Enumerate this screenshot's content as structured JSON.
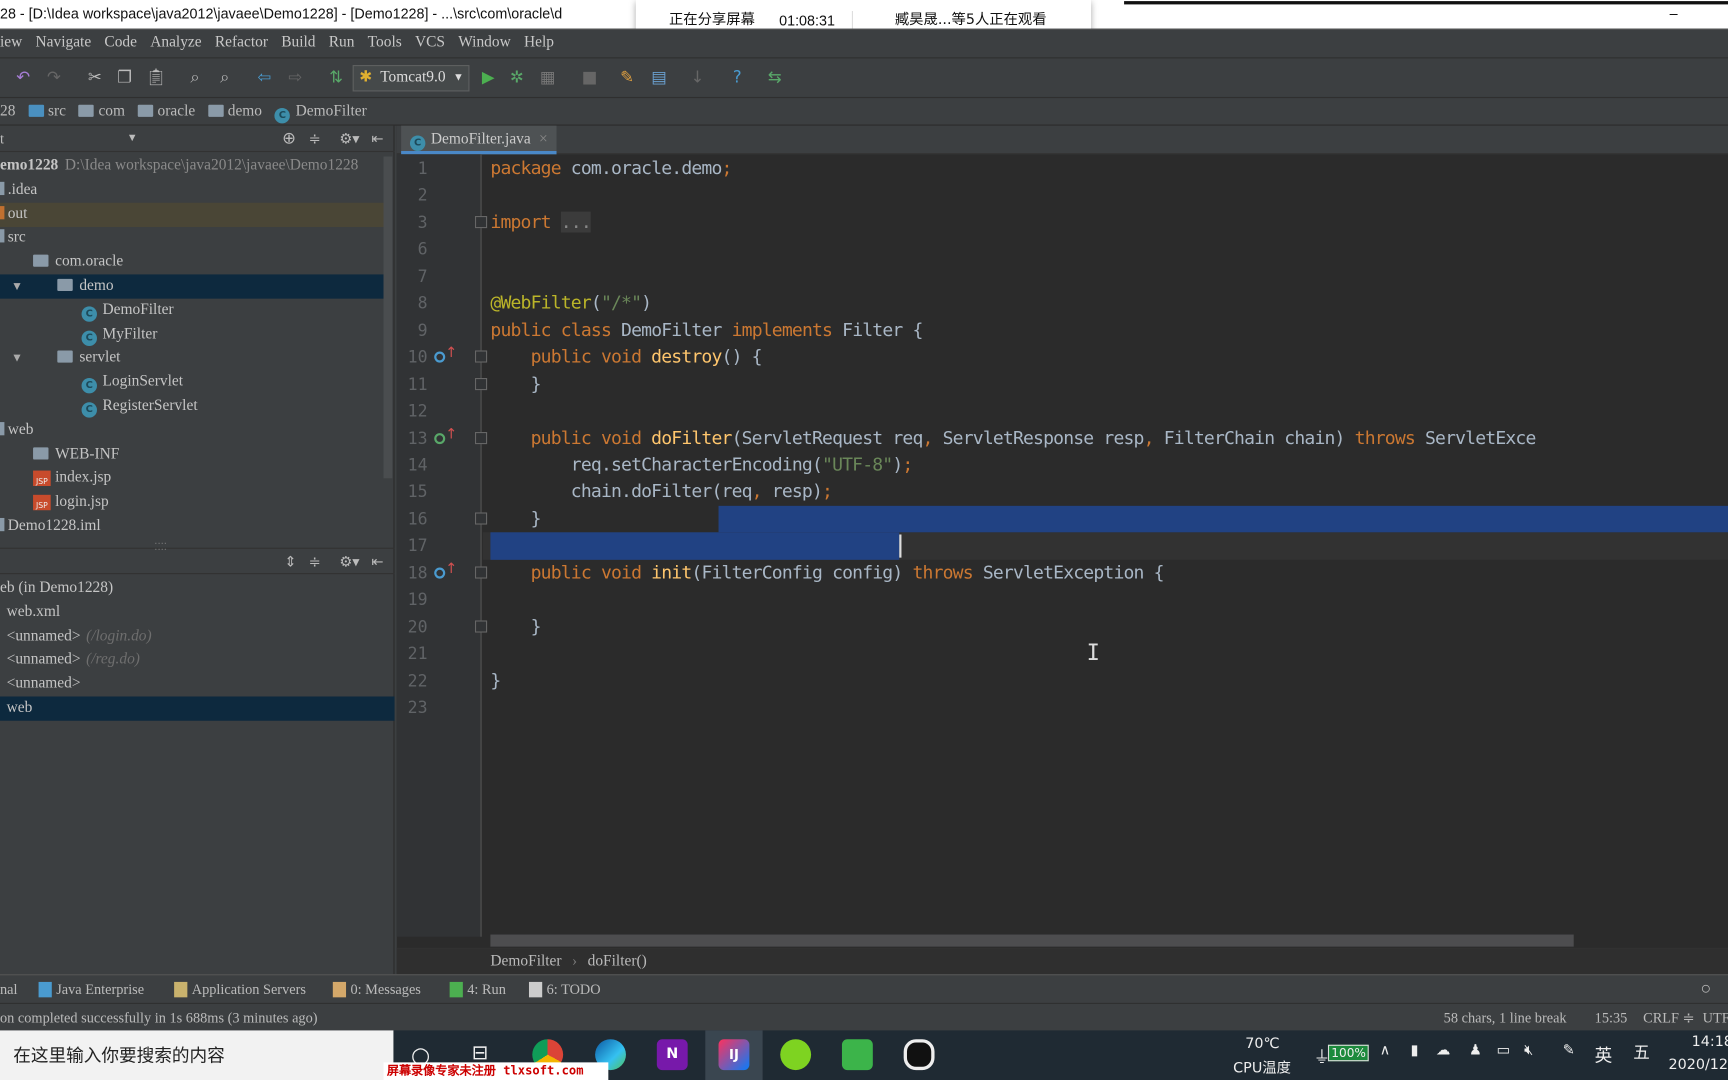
{
  "window": {
    "title": "28 - [D:\\Idea workspace\\java2012\\javaee\\Demo1228] - [Demo1228] - ...\\src\\com\\oracle\\d",
    "minimize": "–"
  },
  "share_overlay": {
    "status": "正在分享屏幕",
    "time": "01:08:31",
    "viewers": "臧昊晟...等5人正在观看"
  },
  "menu": [
    "iew",
    "Navigate",
    "Code",
    "Analyze",
    "Refactor",
    "Build",
    "Run",
    "Tools",
    "VCS",
    "Window",
    "Help"
  ],
  "toolbar": {
    "run_config": "Tomcat9.0",
    "icons": [
      "undo-icon",
      "redo-icon",
      "cut-icon",
      "copy-icon",
      "paste-icon",
      "find-icon",
      "replace-icon",
      "back-icon",
      "forward-icon",
      "make-icon",
      "run-icon",
      "debug-icon",
      "coverage-icon",
      "stop-icon",
      "project-structure-icon",
      "sdk-icon",
      "vcs-icon",
      "help-icon",
      "update-icon"
    ]
  },
  "breadcrumb": [
    "28",
    "src",
    "com",
    "oracle",
    "demo",
    "DemoFilter"
  ],
  "project_panel": {
    "header": "t",
    "tree": [
      {
        "label": "emo1228",
        "extra": "D:\\Idea workspace\\java2012\\javaee\\Demo1228",
        "indent": 0,
        "type": "root"
      },
      {
        "label": ".idea",
        "indent": 0,
        "type": "dir"
      },
      {
        "label": "out",
        "indent": 0,
        "type": "out"
      },
      {
        "label": "src",
        "indent": 0,
        "type": "dir"
      },
      {
        "label": "com.oracle",
        "indent": 1,
        "type": "pkg"
      },
      {
        "label": "demo",
        "indent": 2,
        "type": "pkg",
        "expanded": true,
        "selected": true
      },
      {
        "label": "DemoFilter",
        "indent": 3,
        "type": "class"
      },
      {
        "label": "MyFilter",
        "indent": 3,
        "type": "class"
      },
      {
        "label": "servlet",
        "indent": 2,
        "type": "pkg",
        "expanded": true
      },
      {
        "label": "LoginServlet",
        "indent": 3,
        "type": "class"
      },
      {
        "label": "RegisterServlet",
        "indent": 3,
        "type": "class"
      },
      {
        "label": "web",
        "indent": 0,
        "type": "dir"
      },
      {
        "label": "WEB-INF",
        "indent": 1,
        "type": "folder"
      },
      {
        "label": "index.jsp",
        "indent": 1,
        "type": "jsp"
      },
      {
        "label": "login.jsp",
        "indent": 1,
        "type": "jsp"
      },
      {
        "label": "Demo1228.iml",
        "indent": 0,
        "type": "file"
      }
    ]
  },
  "web_panel": {
    "tree": [
      {
        "label": "eb (in Demo1228)",
        "hint": ""
      },
      {
        "label": "web.xml",
        "hint": ""
      },
      {
        "label": "<unnamed>",
        "hint": "(/login.do)"
      },
      {
        "label": "<unnamed>",
        "hint": "(/reg.do)"
      },
      {
        "label": "<unnamed>",
        "hint": ""
      },
      {
        "label": "web",
        "hint": "",
        "selected": true
      }
    ]
  },
  "editor": {
    "tab": "DemoFilter.java",
    "tab_close": "×",
    "lines": [
      {
        "n": "1",
        "t": [
          [
            "package ",
            "kw"
          ],
          [
            "com.oracle.demo",
            ""
          ],
          [
            ";",
            "kw"
          ]
        ]
      },
      {
        "n": "2",
        "t": []
      },
      {
        "n": "3",
        "t": [
          [
            "import ",
            "kw"
          ],
          [
            "...",
            "fold"
          ]
        ]
      },
      {
        "n": "6",
        "t": []
      },
      {
        "n": "7",
        "t": []
      },
      {
        "n": "8",
        "t": [
          [
            "@WebFilter",
            "ann"
          ],
          [
            "(",
            ""
          ],
          [
            "\"/*\"",
            "str"
          ],
          [
            ")",
            ""
          ]
        ]
      },
      {
        "n": "9",
        "t": [
          [
            "public class ",
            "kw"
          ],
          [
            "DemoFilter ",
            ""
          ],
          [
            "implements ",
            "kw"
          ],
          [
            "Filter {",
            ""
          ]
        ]
      },
      {
        "n": "10",
        "t": [
          [
            "    public void ",
            "kw"
          ],
          [
            "destroy",
            "fn"
          ],
          [
            "() {",
            ""
          ]
        ]
      },
      {
        "n": "11",
        "t": [
          [
            "    }",
            ""
          ]
        ]
      },
      {
        "n": "12",
        "t": []
      },
      {
        "n": "13",
        "t": [
          [
            "    public void ",
            "kw"
          ],
          [
            "doFilter",
            "fn"
          ],
          [
            "(ServletRequest req",
            ""
          ],
          [
            ", ",
            "kw"
          ],
          [
            "ServletResponse resp",
            ""
          ],
          [
            ", ",
            "kw"
          ],
          [
            "FilterChain chain) ",
            ""
          ],
          [
            "throws ",
            "kw"
          ],
          [
            "ServletExce",
            ""
          ]
        ]
      },
      {
        "n": "14",
        "t": [
          [
            "        req.setCharacterEncoding(",
            ""
          ],
          [
            "\"UTF-8\"",
            "str"
          ],
          [
            ")",
            ""
          ],
          [
            ";",
            "kw"
          ]
        ]
      },
      {
        "n": "15",
        "t": [
          [
            "        chain.doFilter(req",
            ""
          ],
          [
            ", ",
            "kw"
          ],
          [
            "resp)",
            ""
          ],
          [
            ";",
            "kw"
          ]
        ]
      },
      {
        "n": "16",
        "t": [
          [
            "    }",
            ""
          ]
        ]
      },
      {
        "n": "17",
        "t": []
      },
      {
        "n": "18",
        "t": [
          [
            "    public void ",
            "kw"
          ],
          [
            "init",
            "fn"
          ],
          [
            "(FilterConfig config) ",
            ""
          ],
          [
            "throws ",
            "kw"
          ],
          [
            "ServletException {",
            ""
          ]
        ]
      },
      {
        "n": "19",
        "t": []
      },
      {
        "n": "20",
        "t": [
          [
            "    }",
            ""
          ]
        ]
      },
      {
        "n": "21",
        "t": []
      },
      {
        "n": "22",
        "t": [
          [
            "}",
            ""
          ]
        ]
      },
      {
        "n": "23",
        "t": []
      }
    ],
    "crumb": [
      "DemoFilter",
      "doFilter()"
    ]
  },
  "tool_windows": [
    "nal",
    "Java Enterprise",
    "Application Servers",
    "0: Messages",
    "4: Run",
    "6: TODO"
  ],
  "status": {
    "message": "on completed successfully in 1s 688ms (3 minutes ago)",
    "selection": "58 chars, 1 line break",
    "position": "15:35",
    "line_sep": "CRLF ≑",
    "encoding": "UTF"
  },
  "taskbar": {
    "search_placeholder": "在这里输入你要搜索的内容",
    "temp": "70℃",
    "temp_label": "CPU温度",
    "battery": "100%",
    "ime": "英",
    "ime2": "五",
    "time": "14:18",
    "date": "2020/12",
    "watermark": "屏幕录像专家未注册 tlxsoft.com"
  },
  "colors": {
    "keyword": "#cc7832",
    "function": "#ffc66d",
    "string": "#6a8759",
    "annotation": "#bbb529",
    "text": "#a9b7c6",
    "selection": "#214283",
    "accent": "#4a88c7"
  }
}
